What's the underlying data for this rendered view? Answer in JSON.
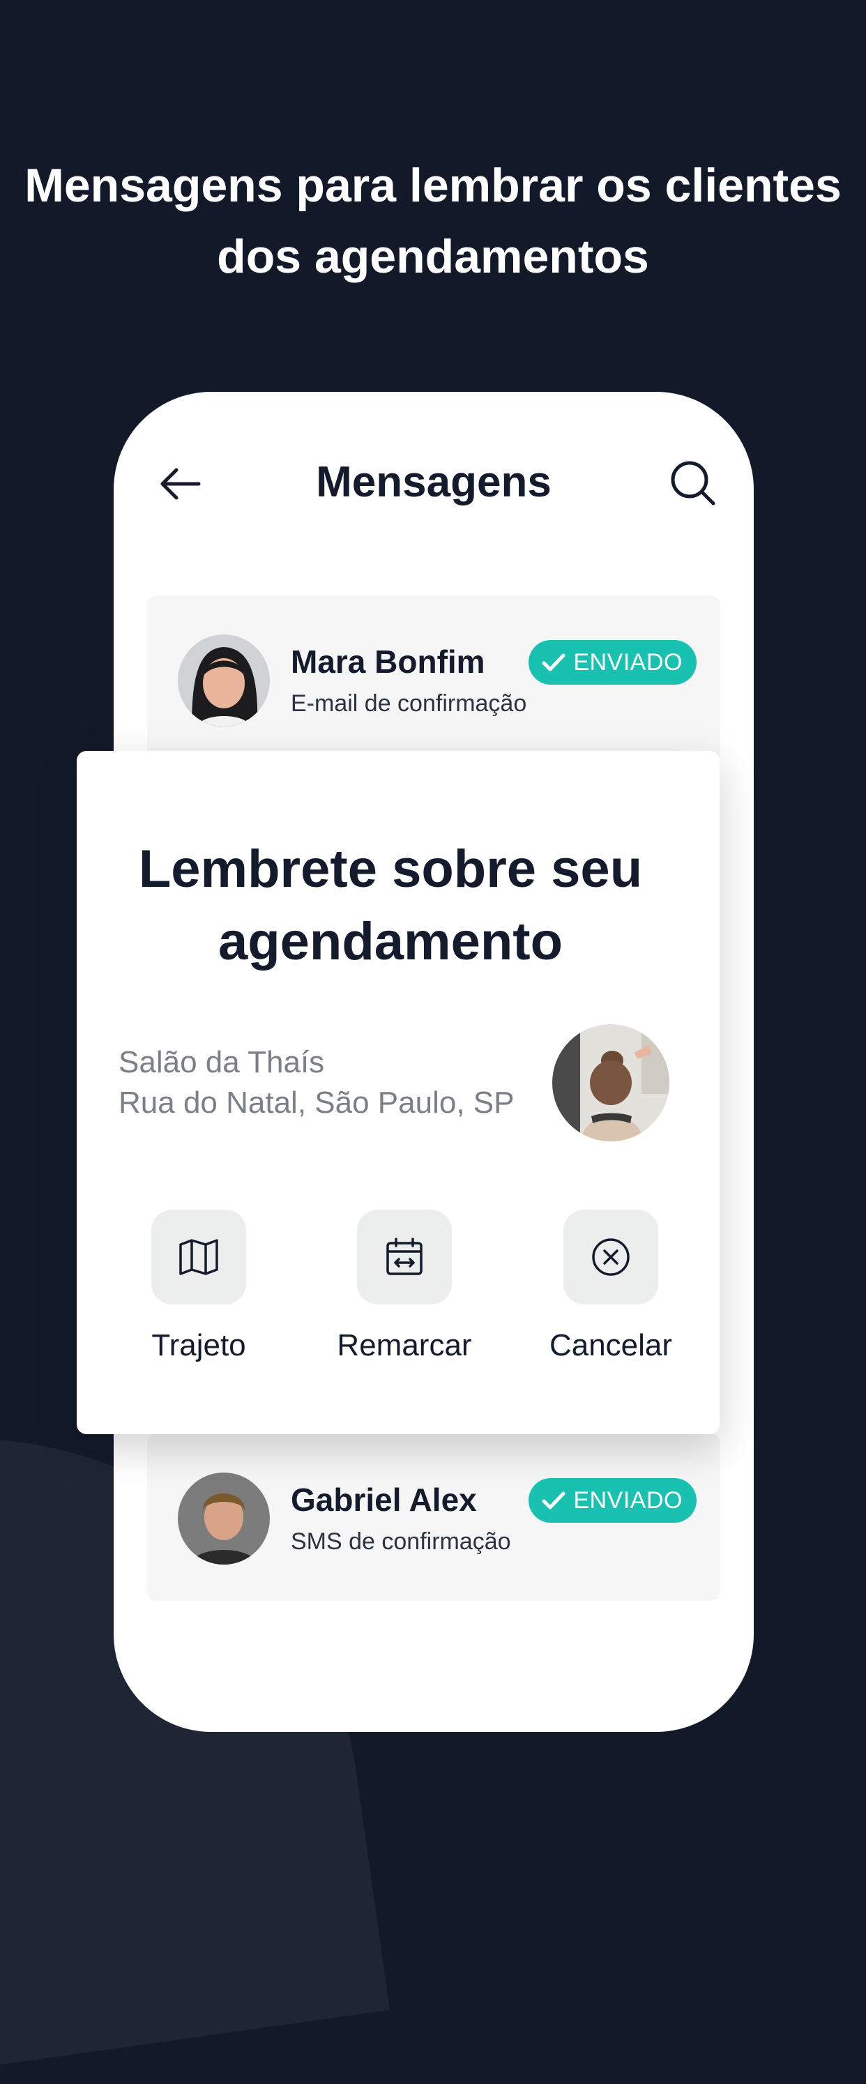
{
  "headline": {
    "line1": "Mensagens para lembrar os clientes",
    "line2": "dos agendamentos"
  },
  "topbar": {
    "title": "Mensagens",
    "back_icon": "arrow-left-icon",
    "search_icon": "search-icon"
  },
  "messages": [
    {
      "name": "Mara Bonfim",
      "subtitle": "E-mail de confirmação",
      "status": "ENVIADO"
    },
    {
      "name": "Gabriel Alex",
      "subtitle": "SMS de confirmação",
      "status": "ENVIADO"
    }
  ],
  "reminder": {
    "title_line1": "Lembrete sobre seu",
    "title_line2": "agendamento",
    "place_name": "Salão da Thaís",
    "place_address": "Rua do Natal, São Paulo, SP",
    "actions": [
      {
        "label": "Trajeto",
        "icon": "map-icon"
      },
      {
        "label": "Remarcar",
        "icon": "calendar-reschedule-icon"
      },
      {
        "label": "Cancelar",
        "icon": "cancel-circle-icon"
      }
    ]
  },
  "colors": {
    "background": "#121a2a",
    "badge": "#19c1b0",
    "text_dark": "#141b2d",
    "text_muted": "#7b7f88"
  }
}
